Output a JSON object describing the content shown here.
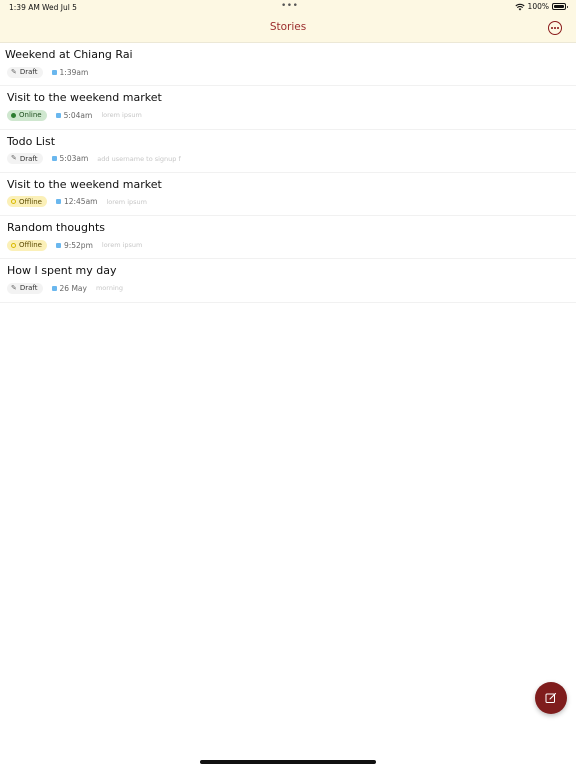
{
  "status": {
    "time": "1:39 AM",
    "date": "Wed Jul 5",
    "battery": "100%"
  },
  "nav": {
    "title": "Stories",
    "more_icon": "ellipsis-circle-icon"
  },
  "stories": [
    {
      "title": "Weekend at Chiang Rai",
      "status": "Draft",
      "time": "1:39am",
      "note": ""
    },
    {
      "title": "Visit to the weekend market",
      "status": "Online",
      "time": "5:04am",
      "note": "lorem ipsum"
    },
    {
      "title": "Todo List",
      "status": "Draft",
      "time": "5:03am",
      "note": "add username to signup f"
    },
    {
      "title": "Visit to the weekend market",
      "status": "Offline",
      "time": "12:45am",
      "note": "lorem ipsum"
    },
    {
      "title": "Random thoughts",
      "status": "Offline",
      "time": "9:52pm",
      "note": "lorem ipsum"
    },
    {
      "title": "How I spent my day",
      "status": "Draft",
      "time": "26 May",
      "note": "morning"
    }
  ],
  "compose": {
    "icon": "compose-icon"
  },
  "colors": {
    "accent": "#7f1d1d",
    "header_bg": "#fdf8e3",
    "online": "#cfe7cf",
    "offline": "#fbf0b8",
    "draft": "#f3f3f3"
  }
}
